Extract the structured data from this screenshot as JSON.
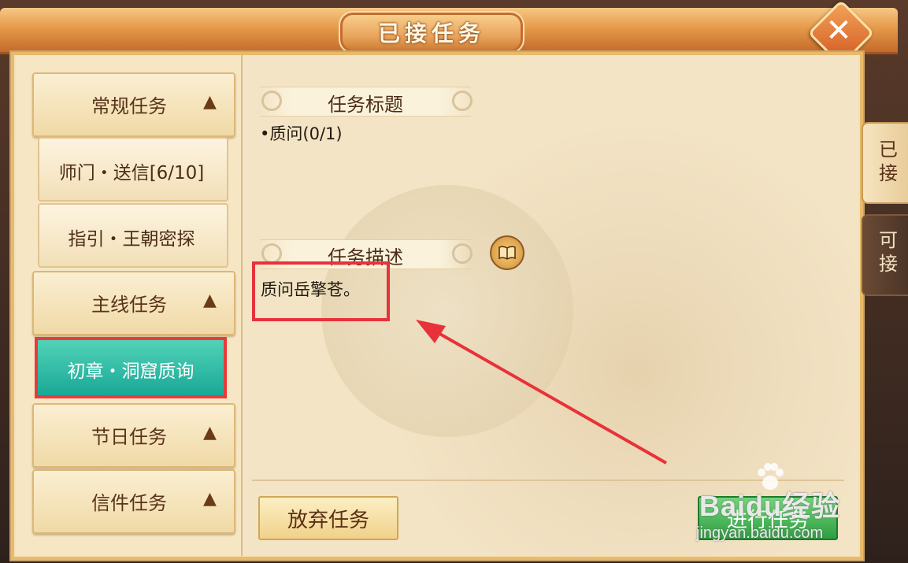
{
  "window": {
    "title": "已接任务",
    "close_icon": "close-icon"
  },
  "sidebar": {
    "categories": [
      {
        "label": "常规任务",
        "arrow": "▲"
      },
      {
        "label": "主线任务",
        "arrow": "▲"
      },
      {
        "label": "节日任务",
        "arrow": "▲"
      },
      {
        "label": "信件任务",
        "arrow": "▲"
      }
    ],
    "regular_items": [
      {
        "label": "师门・送信[6/10]"
      },
      {
        "label": "指引・王朝密探"
      }
    ],
    "main_items": [
      {
        "label": "初章・洞窟质询",
        "selected": true
      }
    ]
  },
  "detail": {
    "title_header": "任务标题",
    "objective": "•质问(0/1)",
    "desc_header": "任务描述",
    "description": "质问岳擎苍。",
    "book_icon": "book-icon"
  },
  "actions": {
    "abandon_label": "放弃任务",
    "proceed_label": "进行任务"
  },
  "tabs": [
    {
      "label": "已接",
      "active": true
    },
    {
      "label": "可接",
      "active": false
    }
  ],
  "watermark": {
    "main": "Baidu经验",
    "sub": "jingyan.baidu.com"
  },
  "colors": {
    "parchment": "#f3e1bb",
    "selected_item": "#19a896",
    "highlight": "#e8323a",
    "proceed": "#2e9e41"
  }
}
